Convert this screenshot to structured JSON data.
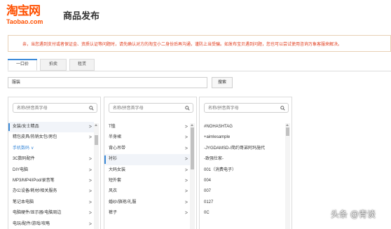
{
  "header": {
    "logo_cn": "淘宝网",
    "logo_en": "Taobao.com",
    "page_title": "商品发布"
  },
  "notice": {
    "text": "亲，当您遇到支付或者保证金、资质认证等问题时，请先确认对方的淘宝小二身份后再沟通，谨防上当受骗。如发布宝贝遇到问题，您也可以尝试使用咨询万象客服来解决。"
  },
  "tabs": [
    {
      "label": "一口价",
      "active": true
    },
    {
      "label": "拍卖",
      "active": false
    },
    {
      "label": "租赁",
      "active": false
    }
  ],
  "search": {
    "value": "服装",
    "button_label": "搜索"
  },
  "filter_placeholder": "名称/拼音首字母",
  "colors": {
    "brand": "#ff5000",
    "accent": "#3d8bd9",
    "notice_text": "#e03a1a"
  },
  "panel1": {
    "items": [
      {
        "label": "女装/女士精品",
        "arrow": ">",
        "selected": true
      },
      {
        "label": "精包皮具/热销女包/男包",
        "arrow": ">"
      },
      {
        "label": "手机数码",
        "group": true,
        "chev": "∨"
      },
      {
        "label": "3C数码配件",
        "arrow": ">"
      },
      {
        "label": "DIY电脑",
        "arrow": ">"
      },
      {
        "label": "MP3/MP4/iPod/录音笔",
        "arrow": ">"
      },
      {
        "label": "办公设备/耗材/相关服务",
        "arrow": ">"
      },
      {
        "label": "笔记本电脑",
        "arrow": ">"
      },
      {
        "label": "电脑硬件/显示器/电脑周边",
        "arrow": ">"
      },
      {
        "label": "电玩/配件/游戏/攻略",
        "arrow": ">"
      }
    ]
  },
  "panel2": {
    "items": [
      {
        "label": "T恤",
        "arrow": ">"
      },
      {
        "label": "半身裙",
        "arrow": ">"
      },
      {
        "label": "背心吊带",
        "arrow": ">"
      },
      {
        "label": "衬衫",
        "arrow": ">",
        "selected": true
      },
      {
        "label": "大码女装",
        "arrow": ">"
      },
      {
        "label": "短外套",
        "arrow": ">"
      },
      {
        "label": "风衣",
        "arrow": ">"
      },
      {
        "label": "婚纱/旗袍/礼服",
        "arrow": ">"
      },
      {
        "label": "裤子",
        "arrow": ">"
      }
    ]
  },
  "panel3": {
    "items": [
      {
        "label": "#NOHASHTAG"
      },
      {
        "label": "+aimlesample"
      },
      {
        "label": "-JYGDAMSD-/简约哥弟阿玛施代"
      },
      {
        "label": "-致强仕家-"
      },
      {
        "label": "001（消费电子）"
      },
      {
        "label": "004"
      },
      {
        "label": "007"
      },
      {
        "label": "0127"
      },
      {
        "label": "0C"
      }
    ]
  },
  "watermark": "头条 @青谈"
}
